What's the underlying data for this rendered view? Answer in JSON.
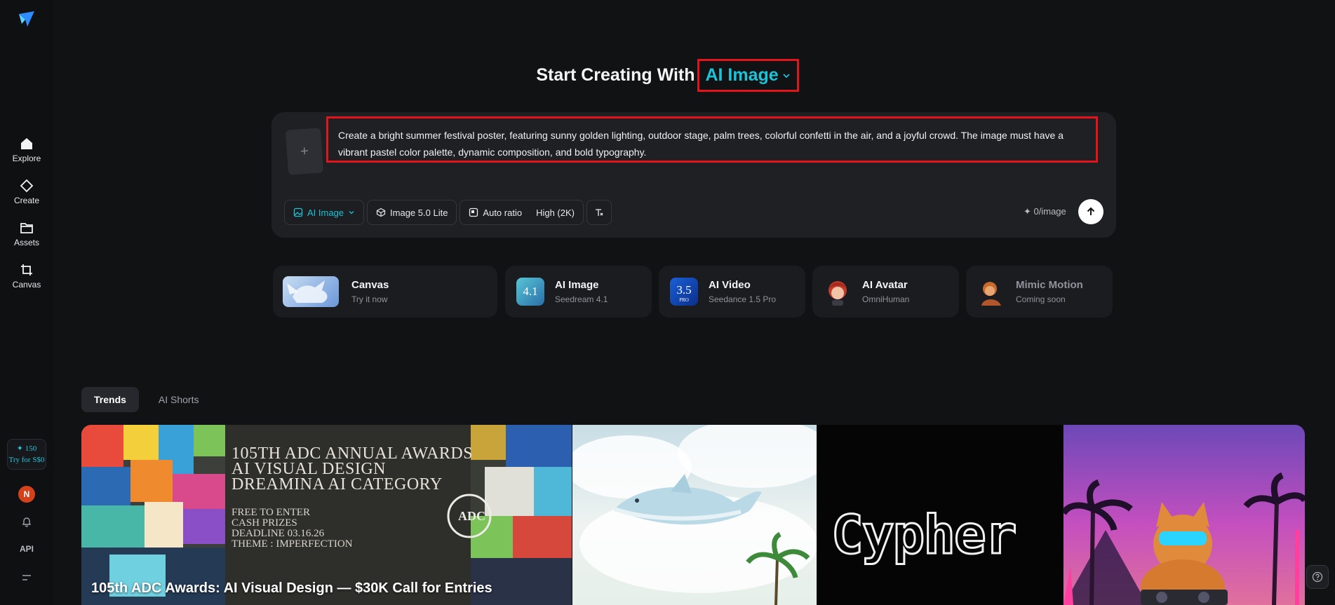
{
  "sidebar": {
    "items": [
      {
        "label": "Explore",
        "icon": "home-icon"
      },
      {
        "label": "Create",
        "icon": "diamond-icon"
      },
      {
        "label": "Assets",
        "icon": "folder-icon"
      },
      {
        "label": "Canvas",
        "icon": "crop-icon"
      }
    ],
    "credits_amount": "✦ 150",
    "credits_offer": "Try for S$0",
    "avatar_initial": "N",
    "api_label": "API"
  },
  "headline": {
    "prefix": "Start Creating With",
    "mode": "AI Image"
  },
  "composer": {
    "upload_glyph": "+",
    "prompt": "Create a bright summer festival poster, featuring sunny golden lighting, outdoor stage, palm trees, colorful confetti in the air, and a joyful crowd. The image must have a vibrant pastel color palette, dynamic composition, and bold typography.",
    "toolbar": {
      "type_label": "AI Image",
      "model_label": "Image 5.0 Lite",
      "ratio_label": "Auto ratio",
      "quality_label": "High (2K)"
    },
    "price": "✦ 0/image"
  },
  "tools": [
    {
      "title": "Canvas",
      "subtitle": "Try it now"
    },
    {
      "title": "AI Image",
      "subtitle": "Seedream 4.1",
      "badge": "4.1"
    },
    {
      "title": "AI Video",
      "subtitle": "Seedance 1.5 Pro",
      "badge": "3.5",
      "badge_sub": "PRO"
    },
    {
      "title": "AI Avatar",
      "subtitle": "OmniHuman"
    },
    {
      "title": "Mimic Motion",
      "subtitle": "Coming soon"
    }
  ],
  "tabs": [
    {
      "label": "Trends",
      "active": true
    },
    {
      "label": "AI Shorts",
      "active": false
    }
  ],
  "gallery": {
    "items": [
      {
        "caption": "105th ADC Awards: AI Visual Design — $30K Call for Entries",
        "poster_lines": [
          "105TH ADC ANNUAL AWARDS",
          "AI VISUAL DESIGN",
          "DREAMINA AI CATEGORY"
        ],
        "poster_small": [
          "FREE TO ENTER",
          "CASH PRIZES",
          "DEADLINE 03.16.26",
          "THEME : IMPERFECTION"
        ],
        "emblem": "ADC"
      },
      {
        "kind": "dolphin-clouds"
      },
      {
        "word": "Cypher"
      },
      {
        "kind": "cat-dj"
      }
    ]
  },
  "colors": {
    "background": "#111214",
    "accent": "#1bc3d8",
    "highlight": "#e3141b"
  }
}
